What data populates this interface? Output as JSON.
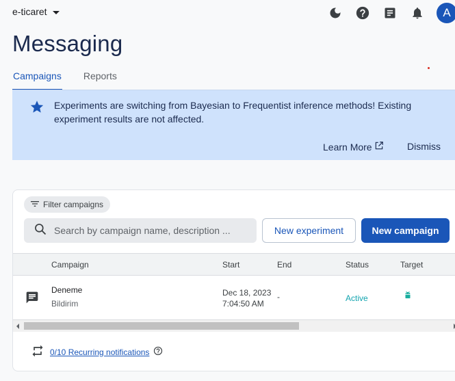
{
  "topbar": {
    "project_name": "e-ticaret",
    "icons": [
      "dark-mode-icon",
      "help-icon",
      "feedback-icon",
      "notifications-icon"
    ],
    "avatar_letter": "A"
  },
  "page": {
    "title": "Messaging"
  },
  "tabs": [
    {
      "label": "Campaigns",
      "active": true
    },
    {
      "label": "Reports",
      "active": false
    }
  ],
  "banner": {
    "message": "Experiments are switching from Bayesian to Frequentist inference methods! Existing experiment results are not affected.",
    "learn_more": "Learn More",
    "dismiss": "Dismiss"
  },
  "campaigns": {
    "filter_label": "Filter campaigns",
    "search_placeholder": "Search by campaign name, description ...",
    "new_experiment_label": "New experiment",
    "new_campaign_label": "New campaign",
    "columns": [
      "Campaign",
      "Start",
      "End",
      "Status",
      "Target"
    ],
    "rows": [
      {
        "name": "Deneme",
        "type": "Bildirim",
        "start_date": "Dec 18, 2023",
        "start_time": "7:04:50 AM",
        "end": "-",
        "status": "Active",
        "target_icon": "android-icon"
      }
    ],
    "recurring_link": "0/10 Recurring notifications"
  },
  "colors": {
    "accent": "#1a56b8",
    "banner_bg": "#cfe2fc",
    "status_active": "#12a4af",
    "android": "#1aae9f"
  }
}
